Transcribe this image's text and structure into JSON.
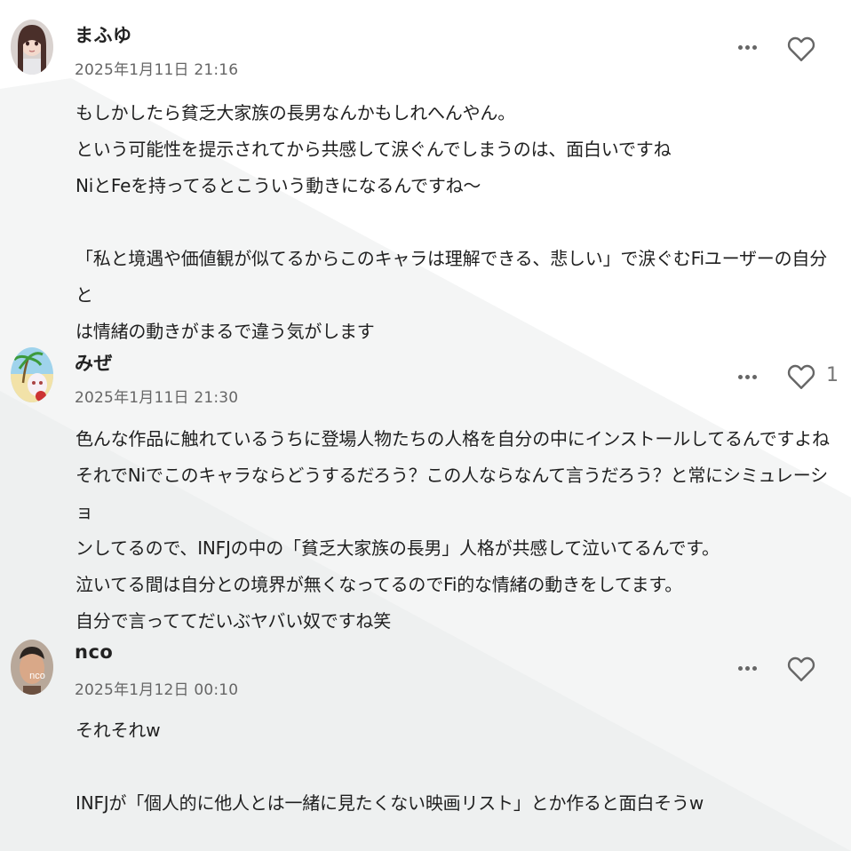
{
  "comments": [
    {
      "author": "まふゆ",
      "timestamp": "2025年1月11日 21:16",
      "avatar_icon": "avatar-girl-illustration",
      "like_count": "",
      "lines": [
        "もしかしたら貧乏大家族の長男なんかもしれへんやん。",
        "という可能性を提示されてから共感して涙ぐんでしまうのは、面白いですね",
        "NiとFeを持ってるとこういう動きになるんですね〜",
        "",
        "「私と境遇や価値観が似てるからこのキャラは理解できる、悲しい」で涙ぐむFiユーザーの自分と",
        "は情緒の動きがまるで違う気がします"
      ]
    },
    {
      "author": "みぜ",
      "timestamp": "2025年1月11日 21:30",
      "avatar_icon": "avatar-beach-illustration",
      "like_count": "1",
      "lines": [
        "色んな作品に触れているうちに登場人物たちの人格を自分の中にインストールしてるんですよね",
        "それでNiでこのキャラならどうするだろう？この人ならなんて言うだろう？と常にシミュレーショ",
        "ンしてるので、INFJの中の「貧乏大家族の長男」人格が共感して泣いてるんです。",
        "泣いてる間は自分との境界が無くなってるのでFi的な情緒の動きをしてます。",
        "自分で言っててだいぶヤバい奴ですね笑"
      ]
    },
    {
      "author": "nco",
      "timestamp": "2025年1月12日 00:10",
      "avatar_icon": "avatar-photo-man",
      "avatar_text": "nco",
      "like_count": "",
      "lines": [
        "それそれw",
        "",
        "INFJが「個人的に他人とは一緒に見たくない映画リスト」とか作ると面白そうw"
      ]
    }
  ],
  "icons": {
    "more": "more-horizontal-icon",
    "like": "heart-outline-icon"
  },
  "colors": {
    "background": "#ffffff",
    "stripe": "#f4f5f5",
    "text": "#1f1f1f",
    "muted": "#666666",
    "icon": "#666666"
  }
}
